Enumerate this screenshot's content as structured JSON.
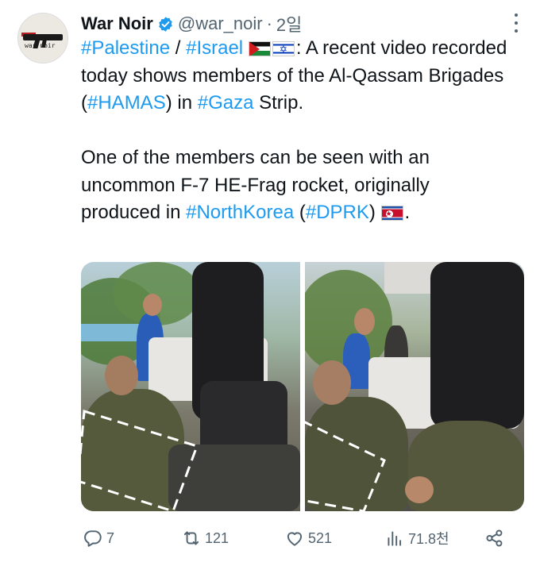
{
  "author": {
    "name": "War Noir",
    "handle": "@war_noir",
    "separator": "·",
    "time": "2일",
    "avatar_text": "war noir"
  },
  "tweet": {
    "line1": {
      "tag1": "#Palestine",
      "sep": " / ",
      "tag2": "#Israel",
      "flags": [
        "palestine-flag",
        "israel-flag"
      ],
      "after_flags": ": A recent video recorded today shows members of the Al-Qassam Brigades (",
      "tag3": "#HAMAS",
      "mid": ") in ",
      "tag4": "#Gaza",
      "end": " Strip."
    },
    "line2": {
      "start": "One of the members can be seen with an uncommon F-7 HE-Frag rocket, originally produced in ",
      "tag1": "#NorthKorea",
      "mid": " (",
      "tag2": "#DPRK",
      "mid2": ") ",
      "flag": "north-korea-flag",
      "end": "."
    }
  },
  "stats": {
    "replies": "7",
    "reposts": "121",
    "likes": "521",
    "views": "71.8천"
  },
  "colors": {
    "link": "#1d9bf0",
    "muted": "#536471",
    "verified": "#1d9bf0",
    "text": "#0f1419"
  },
  "icons": [
    "verified-badge-icon",
    "more-options-icon",
    "reply-icon",
    "repost-icon",
    "like-icon",
    "views-icon",
    "share-icon"
  ]
}
